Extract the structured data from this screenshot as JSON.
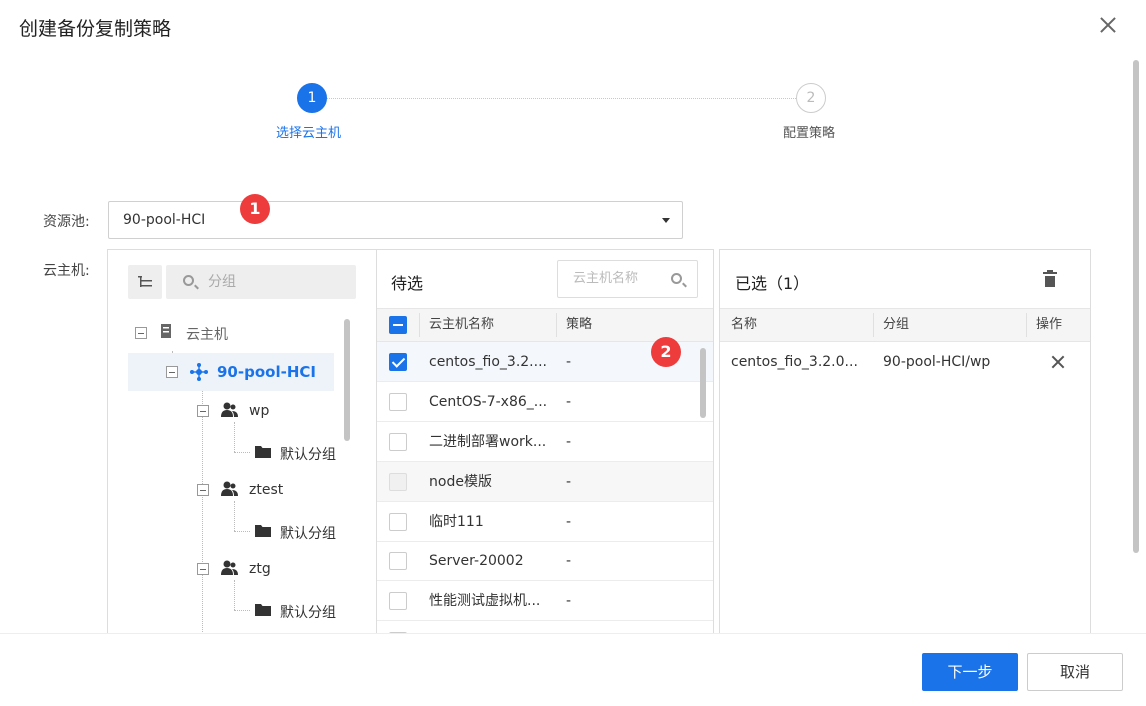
{
  "dialog": {
    "title": "创建备份复制策略"
  },
  "steps": [
    {
      "number": "1",
      "label": "选择云主机",
      "active": true
    },
    {
      "number": "2",
      "label": "配置策略",
      "active": false
    }
  ],
  "form": {
    "pool_label": "资源池:",
    "pool_value": "90-pool-HCI",
    "vm_label": "云主机:"
  },
  "badges": [
    "1",
    "2"
  ],
  "tree": {
    "search_placeholder": "分组",
    "root": "云主机",
    "pool": "90-pool-HCI",
    "groups": [
      {
        "name": "wp",
        "child": "默认分组"
      },
      {
        "name": "ztest",
        "child": "默认分组"
      },
      {
        "name": "ztg",
        "child": "默认分组"
      }
    ]
  },
  "candidates": {
    "title": "待选",
    "search_placeholder": "云主机名称",
    "col_name": "云主机名称",
    "col_policy": "策略",
    "rows": [
      {
        "name": "centos_fio_3.2....",
        "policy": "-",
        "state": "checked"
      },
      {
        "name": "CentOS-7-x86_...",
        "policy": "-",
        "state": "unchecked"
      },
      {
        "name": "二进制部署work...",
        "policy": "-",
        "state": "unchecked"
      },
      {
        "name": "node模版",
        "policy": "-",
        "state": "disabled"
      },
      {
        "name": "临时111",
        "policy": "-",
        "state": "unchecked"
      },
      {
        "name": "Server-20002",
        "policy": "-",
        "state": "unchecked"
      },
      {
        "name": "性能测试虚拟机...",
        "policy": "-",
        "state": "unchecked"
      }
    ]
  },
  "selected": {
    "title": "已选（1）",
    "col_name": "名称",
    "col_group": "分组",
    "col_action": "操作",
    "rows": [
      {
        "name": "centos_fio_3.2.0...",
        "group": "90-pool-HCI/wp"
      }
    ]
  },
  "footer": {
    "next": "下一步",
    "cancel": "取消"
  },
  "colors": {
    "accent": "#1a73e8",
    "badge": "#ee3c3c"
  }
}
